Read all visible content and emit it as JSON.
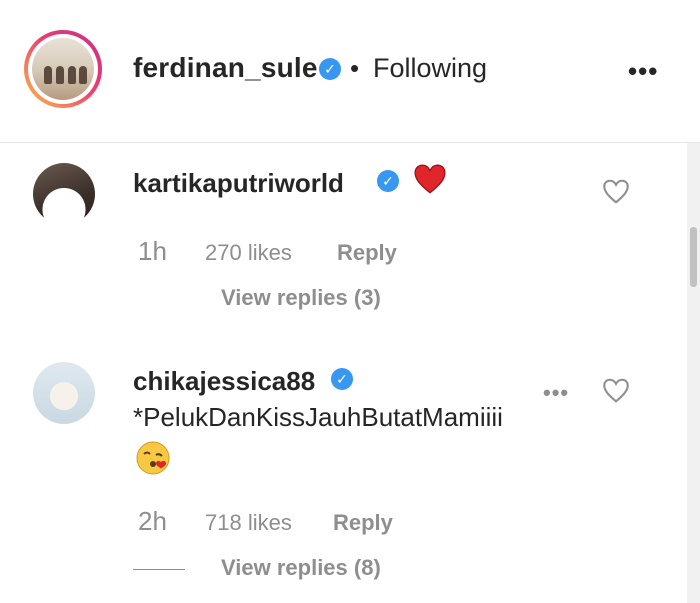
{
  "header": {
    "username": "ferdinan_sule",
    "verified_mark": "✓",
    "separator": "•",
    "follow_status": "Following",
    "more": "•••"
  },
  "comments": [
    {
      "username": "kartikaputriworld",
      "verified_mark": "✓",
      "text_emoji": "heart-emoji",
      "time": "1h",
      "likes": "270 likes",
      "reply": "Reply",
      "view_replies": "View replies (3)"
    },
    {
      "username": "chikajessica88",
      "verified_mark": "✓",
      "text": "*PelukDanKissJauhButatMamiiii",
      "text_emoji": "face-blowing-kiss-emoji",
      "options": "•••",
      "time": "2h",
      "likes": "718 likes",
      "reply": "Reply",
      "view_replies": "View replies (8)"
    }
  ],
  "colors": {
    "verified_blue": "#3897f0",
    "heart_red": "#e0252b",
    "secondary_text": "#8e8e8e",
    "primary_text": "#262626"
  }
}
